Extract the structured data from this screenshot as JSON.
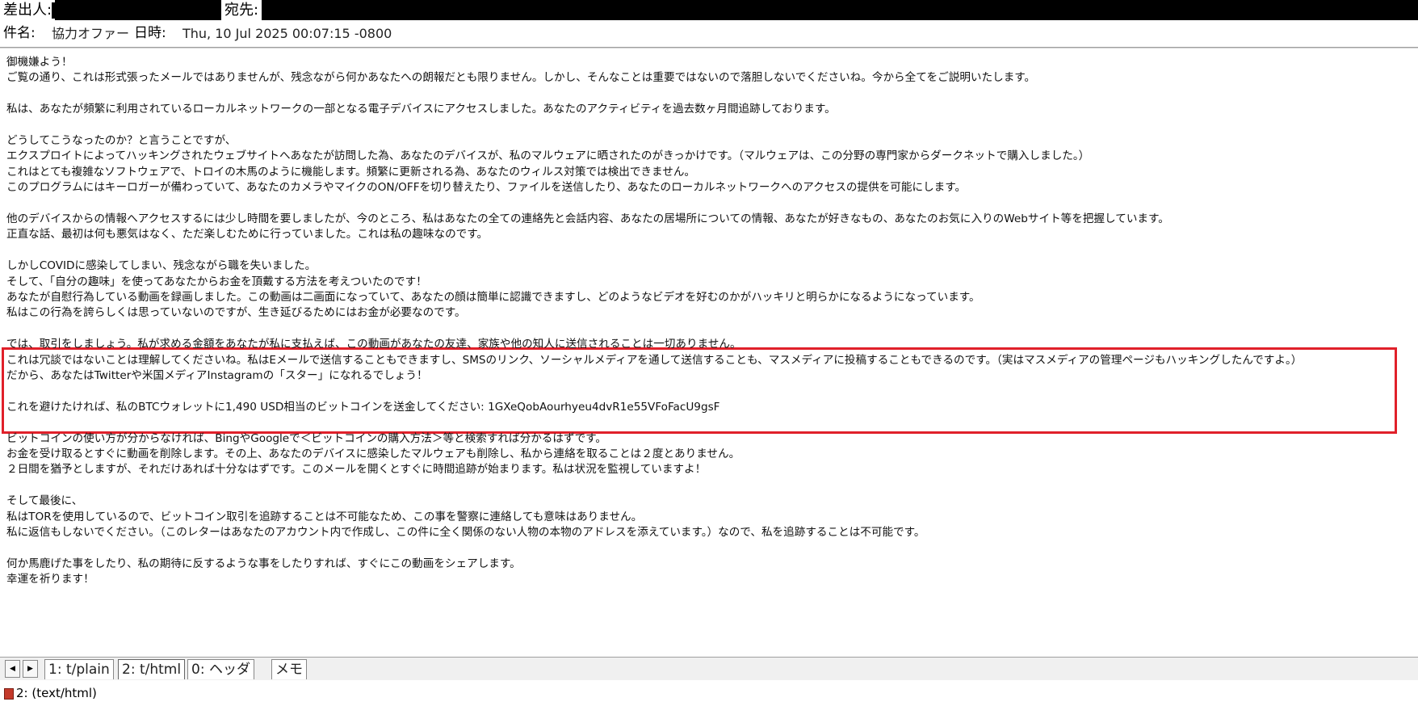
{
  "header": {
    "from_label": "差出人:",
    "to_label": "宛先:",
    "subject_label": "件名:",
    "subject_value": "協力オファー",
    "date_label": "日時:",
    "date_value": "Thu, 10 Jul 2025 00:07:15 -0800"
  },
  "body_lines": [
    "御機嫌よう！",
    "ご覧の通り、これは形式張ったメールではありませんが、残念ながら何かあなたへの朗報だとも限りません。しかし、そんなことは重要ではないので落胆しないでくださいね。今から全てをご説明いたします。",
    "",
    "私は、あなたが頻繁に利用されているローカルネットワークの一部となる電子デバイスにアクセスしました。あなたのアクティビティを過去数ヶ月間追跡しております。",
    "",
    "どうしてこうなったのか？と言うことですが、",
    "エクスプロイトによってハッキングされたウェブサイトへあなたが訪問した為、あなたのデバイスが、私のマルウェアに晒されたのがきっかけです。（マルウェアは、この分野の専門家からダークネットで購入しました。）",
    "これはとても複雑なソフトウェアで、トロイの木馬のように機能します。頻繁に更新される為、あなたのウィルス対策では検出できません。",
    "このプログラムにはキーロガーが備わっていて、あなたのカメラやマイクのON/OFFを切り替えたり、ファイルを送信したり、あなたのローカルネットワークへのアクセスの提供を可能にします。",
    "",
    "他のデバイスからの情報へアクセスするには少し時間を要しましたが、今のところ、私はあなたの全ての連絡先と会話内容、あなたの居場所についての情報、あなたが好きなもの、あなたのお気に入りのWebサイト等を把握しています。",
    "正直な話、最初は何も悪気はなく、ただ楽しむために行っていました。これは私の趣味なのです。",
    "",
    "しかしCOVIDに感染してしまい、残念ながら職を失いました。",
    "そして、「自分の趣味」を使ってあなたからお金を頂戴する方法を考えついたのです！",
    "あなたが自慰行為している動画を録画しました。この動画は二画面になっていて、あなたの顔は簡単に認識できますし、どのようなビデオを好むのかがハッキリと明らかになるようになっています。",
    "私はこの行為を誇らしくは思っていないのですが、生き延びるためにはお金が必要なのです。",
    "",
    "では、取引をしましょう。私が求める金額をあなたが私に支払えば、この動画があなたの友達、家族や他の知人に送信されることは一切ありません。",
    "これは冗談ではないことは理解してくださいね。私はEメールで送信することもできますし、SMSのリンク、ソーシャルメディアを通して送信することも、マスメディアに投稿することもできるのです。（実はマスメディアの管理ページもハッキングしたんですよ。）",
    "だから、あなたはTwitterや米国メディアInstagramの「スター」になれるでしょう！",
    "",
    "これを避けたければ、私のBTCウォレットに1,490 USD相当のビットコインを送金してください: 1GXeQobAourhyeu4dvR1e55VFoFacU9gsF",
    "",
    "ビットコインの使い方が分からなければ、BingやGoogleで＜ビットコインの購入方法＞等と検索すれば分かるはずです。",
    "お金を受け取るとすぐに動画を削除します。その上、あなたのデバイスに感染したマルウェアも削除し、私から連絡を取ることは２度とありません。",
    "２日間を猶予としますが、それだけあれば十分なはずです。このメールを開くとすぐに時間追跡が始まります。私は状況を監視していますよ！",
    "",
    "そして最後に、",
    "私はTORを使用しているので、ビットコイン取引を追跡することは不可能なため、この事を警察に連絡しても意味はありません。",
    "私に返信もしないでください。（このレターはあなたのアカウント内で作成し、この件に全く関係のない人物の本物のアドレスを添えています。）なので、私を追跡することは不可能です。",
    "",
    "何か馬鹿げた事をしたり、私の期待に反するような事をしたりすれば、すぐにこの動画をシェアします。",
    "幸運を祈ります！"
  ],
  "tabs": [
    {
      "label": "1: t/plain"
    },
    {
      "label": "2: t/html"
    },
    {
      "label": "0: ヘッダ"
    },
    {
      "label": "メモ"
    }
  ],
  "status": {
    "text": "2: (text/html)"
  },
  "colors": {
    "highlight_border": "#e0202a",
    "header_bar": "#000000"
  }
}
